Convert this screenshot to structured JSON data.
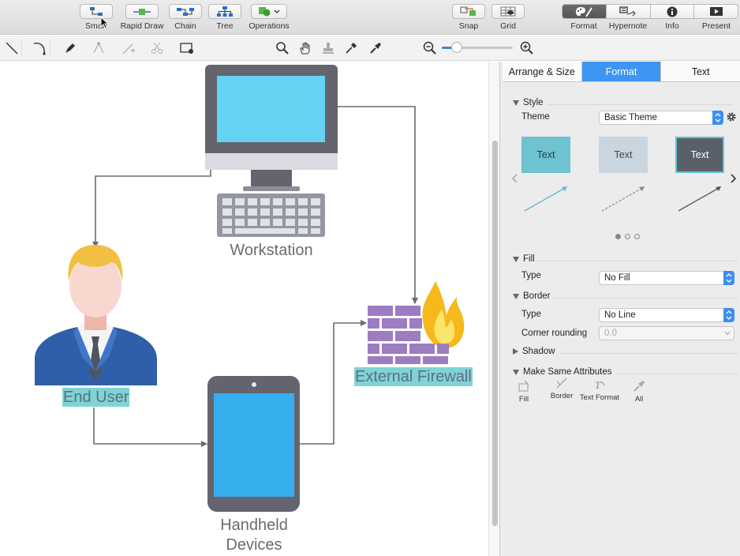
{
  "toolbar": {
    "items": [
      {
        "label": "Smart",
        "icon": "smart-connector-icon"
      },
      {
        "label": "Rapid Draw",
        "icon": "rapid-draw-icon"
      },
      {
        "label": "Chain",
        "icon": "chain-icon"
      },
      {
        "label": "Tree",
        "icon": "tree-icon"
      },
      {
        "label": "Operations",
        "icon": "operations-icon"
      },
      {
        "label": "Snap",
        "icon": "snap-icon"
      },
      {
        "label": "Grid",
        "icon": "grid-icon"
      }
    ],
    "right_segments": [
      {
        "label": "Format",
        "icon": "palette-icon"
      },
      {
        "label": "Hypernote",
        "icon": "hypernote-icon"
      },
      {
        "label": "Info",
        "icon": "info-icon"
      },
      {
        "label": "Present",
        "icon": "present-icon"
      }
    ]
  },
  "canvas": {
    "shapes": {
      "workstation": "Workstation",
      "end_user": "End User",
      "firewall": "External Firewall",
      "handheld_line1": "Handheld",
      "handheld_line2": "Devices"
    }
  },
  "inspector": {
    "tabs": [
      "Arrange & Size",
      "Format",
      "Text"
    ],
    "active_tab": "Format",
    "style": {
      "section": "Style",
      "theme_label": "Theme",
      "theme_value": "Basic Theme",
      "swatches": [
        {
          "text": "Text",
          "bg": "#6fc2cf",
          "fg": "#1f3f4a"
        },
        {
          "text": "Text",
          "bg": "#c9d5df",
          "fg": "#3a4650"
        },
        {
          "text": "Text",
          "bg": "#5a6069",
          "fg": "#ffffff"
        }
      ]
    },
    "fill": {
      "section": "Fill",
      "type_label": "Type",
      "type_value": "No Fill"
    },
    "border": {
      "section": "Border",
      "type_label": "Type",
      "type_value": "No Line",
      "corner_label": "Corner rounding",
      "corner_value": "0.0"
    },
    "shadow": {
      "section": "Shadow"
    },
    "same_attributes": {
      "section": "Make Same Attributes",
      "items": [
        "Fill",
        "Border",
        "Text Format",
        "All"
      ]
    }
  },
  "colors": {
    "accent": "#3d96f2",
    "monitor_frame": "#63646e",
    "screen": "#63d2f3",
    "tablet_screen": "#36aeee",
    "firewall_brick": "#9d7cc2",
    "suit": "#2f5fa8",
    "hair": "#f1c042",
    "label_highlight": "#7fd3d6"
  }
}
